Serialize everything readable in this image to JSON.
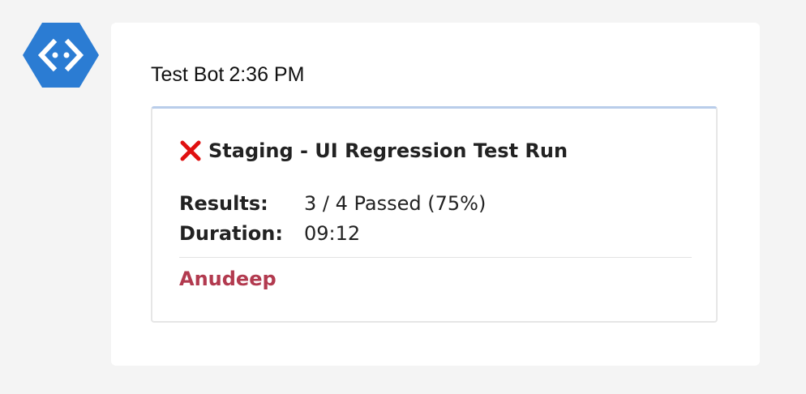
{
  "bot": {
    "avatar_icon": "bot-hexagon-icon",
    "avatar_color": "#2b7cd3"
  },
  "message": {
    "sender": "Test Bot",
    "timestamp": "2:36 PM"
  },
  "card": {
    "accent_color": "#b9cdea",
    "status_icon": "red-x-icon",
    "status_color": "#e01010",
    "title": "Staging - UI Regression Test Run",
    "facts": [
      {
        "key": "Results:",
        "value": "3 / 4 Passed (75%)"
      },
      {
        "key": "Duration:",
        "value": "09:12"
      }
    ],
    "author": "Anudeep",
    "author_color": "#b23a4f"
  }
}
